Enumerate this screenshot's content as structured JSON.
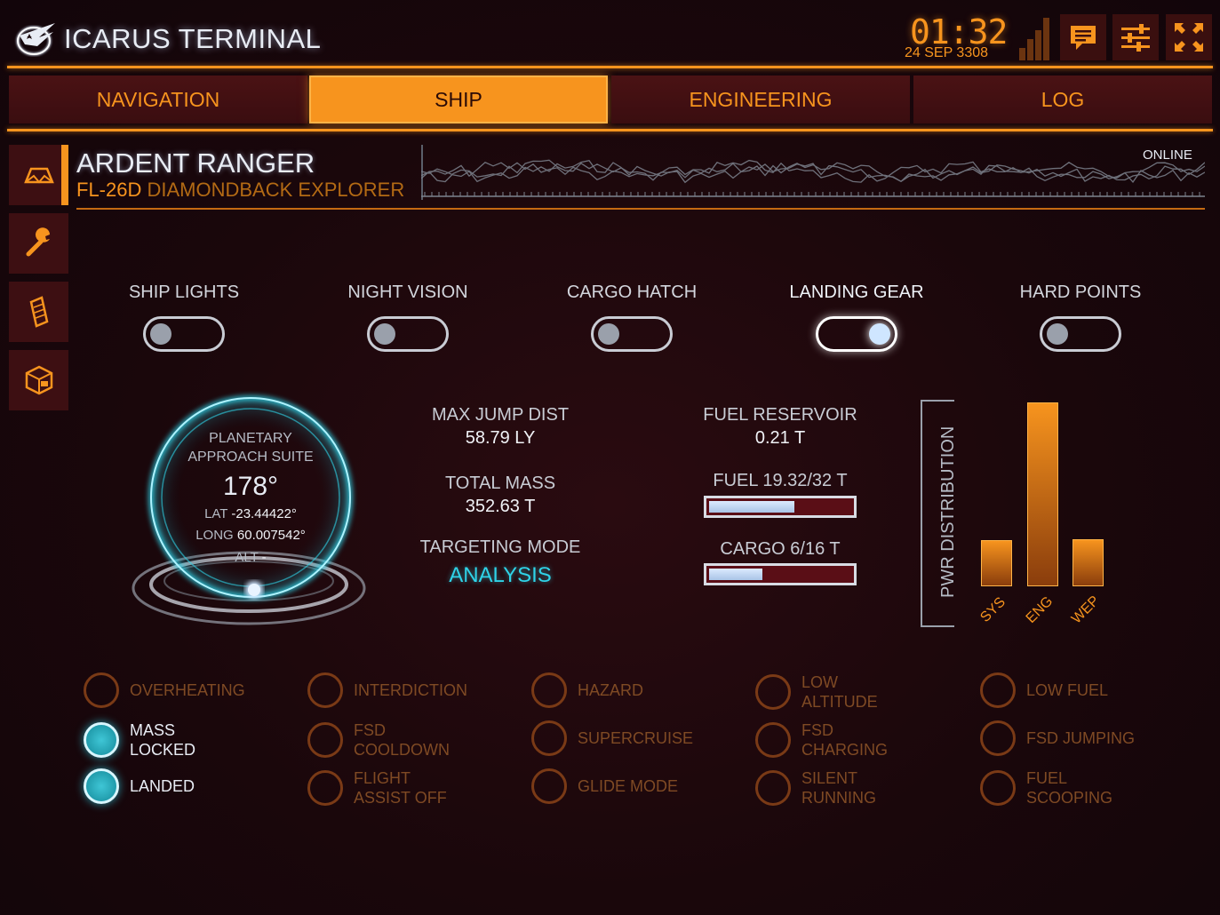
{
  "app": {
    "title": "ICARUS TERMINAL"
  },
  "header": {
    "time": "01:32",
    "date": "24 SEP 3308"
  },
  "tabs": [
    {
      "label": "NAVIGATION",
      "active": false
    },
    {
      "label": "SHIP",
      "active": true
    },
    {
      "label": "ENGINEERING",
      "active": false
    },
    {
      "label": "LOG",
      "active": false
    }
  ],
  "sidebar": [
    {
      "icon": "ship-icon",
      "active": true
    },
    {
      "icon": "wrench-icon",
      "active": false
    },
    {
      "icon": "fuel-icon",
      "active": false
    },
    {
      "icon": "cargo-icon",
      "active": false
    }
  ],
  "ship": {
    "name": "ARDENT RANGER",
    "ident": "FL-26D",
    "model": "DIAMONDBACK EXPLORER",
    "status": "ONLINE"
  },
  "toggles": [
    {
      "label": "SHIP LIGHTS",
      "on": false
    },
    {
      "label": "NIGHT VISION",
      "on": false
    },
    {
      "label": "CARGO HATCH",
      "on": false
    },
    {
      "label": "LANDING GEAR",
      "on": true
    },
    {
      "label": "HARD POINTS",
      "on": false
    }
  ],
  "approach": {
    "title_line1": "PLANETARY",
    "title_line2": "APPROACH SUITE",
    "heading": "178°",
    "lat_label": "LAT",
    "lat": "-23.44422°",
    "long_label": "LONG",
    "long": "60.007542°",
    "alt_label": "ALT",
    "alt": "-"
  },
  "stats": {
    "max_jump_label": "MAX JUMP DIST",
    "max_jump": "58.79 LY",
    "total_mass_label": "TOTAL MASS",
    "total_mass": "352.63 T",
    "targeting_label": "TARGETING MODE",
    "targeting": "ANALYSIS",
    "fuel_reservoir_label": "FUEL RESERVOIR",
    "fuel_reservoir": "0.21 T",
    "fuel_label": "FUEL 19.32/32 T",
    "fuel_fraction": 0.6,
    "cargo_label": "CARGO 6/16 T",
    "cargo_fraction": 0.375
  },
  "power": {
    "label": "PWR DISTRIBUTION",
    "sys_label": "SYS",
    "sys_pips": 1,
    "eng_label": "ENG",
    "eng_pips": 4,
    "wep_label": "WEP",
    "wep_pips": 1
  },
  "indicators": [
    {
      "label": "OVERHEATING",
      "active": false
    },
    {
      "label": "INTERDICTION",
      "active": false
    },
    {
      "label": "HAZARD",
      "active": false
    },
    {
      "label": "LOW\nALTITUDE",
      "active": false
    },
    {
      "label": "LOW FUEL",
      "active": false
    },
    {
      "label": "MASS\nLOCKED",
      "active": true
    },
    {
      "label": "FSD\nCOOLDOWN",
      "active": false
    },
    {
      "label": "SUPERCRUISE",
      "active": false
    },
    {
      "label": "FSD\nCHARGING",
      "active": false
    },
    {
      "label": "FSD JUMPING",
      "active": false
    },
    {
      "label": "LANDED",
      "active": true
    },
    {
      "label": "FLIGHT\nASSIST OFF",
      "active": false
    },
    {
      "label": "GLIDE MODE",
      "active": false
    },
    {
      "label": "SILENT\nRUNNING",
      "active": false
    },
    {
      "label": "FUEL\nSCOOPING",
      "active": false
    }
  ],
  "colors": {
    "accent": "#f7941e",
    "background": "#1a070b",
    "cyan": "#2fd3e8",
    "inactive_indicator": "#7a3a16"
  }
}
